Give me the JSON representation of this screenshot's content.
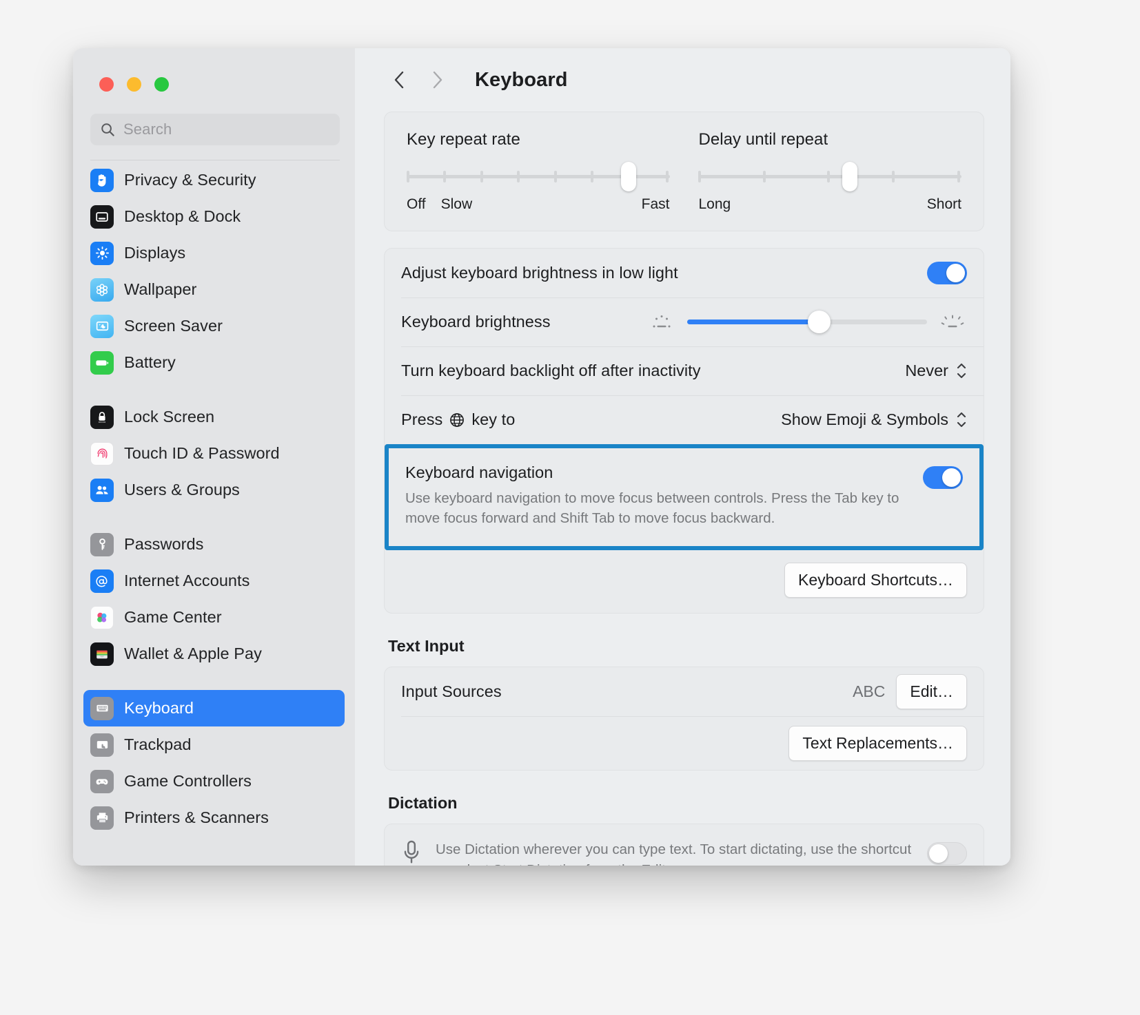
{
  "window": {
    "traffic_lights": [
      "close",
      "minimize",
      "zoom"
    ],
    "colors": {
      "accent": "#2f80f6",
      "highlight_border": "#1a84c7",
      "selected_row": "#2f80f6"
    }
  },
  "sidebar": {
    "search": {
      "placeholder": "Search",
      "value": "",
      "icon": "search-icon"
    },
    "groups": [
      {
        "items": [
          {
            "label": "Privacy & Security",
            "icon": "hand-raised-icon",
            "selected": false
          },
          {
            "label": "Desktop & Dock",
            "icon": "desktop-dock-icon",
            "selected": false
          },
          {
            "label": "Displays",
            "icon": "display-brightness-icon",
            "selected": false
          },
          {
            "label": "Wallpaper",
            "icon": "wallpaper-flower-icon",
            "selected": false
          },
          {
            "label": "Screen Saver",
            "icon": "screen-saver-icon",
            "selected": false
          },
          {
            "label": "Battery",
            "icon": "battery-icon",
            "selected": false
          }
        ]
      },
      {
        "items": [
          {
            "label": "Lock Screen",
            "icon": "lock-icon",
            "selected": false
          },
          {
            "label": "Touch ID & Password",
            "icon": "fingerprint-icon",
            "selected": false
          },
          {
            "label": "Users & Groups",
            "icon": "users-groups-icon",
            "selected": false
          }
        ]
      },
      {
        "items": [
          {
            "label": "Passwords",
            "icon": "key-icon",
            "selected": false
          },
          {
            "label": "Internet Accounts",
            "icon": "at-sign-icon",
            "selected": false
          },
          {
            "label": "Game Center",
            "icon": "game-center-icon",
            "selected": false
          },
          {
            "label": "Wallet & Apple Pay",
            "icon": "wallet-icon",
            "selected": false
          }
        ]
      },
      {
        "items": [
          {
            "label": "Keyboard",
            "icon": "keyboard-icon",
            "selected": true
          },
          {
            "label": "Trackpad",
            "icon": "trackpad-icon",
            "selected": false
          },
          {
            "label": "Game Controllers",
            "icon": "game-controller-icon",
            "selected": false
          },
          {
            "label": "Printers & Scanners",
            "icon": "printer-icon",
            "selected": false
          }
        ]
      }
    ]
  },
  "toolbar": {
    "back_icon": "chevron-left-icon",
    "forward_icon": "chevron-right-icon",
    "title": "Keyboard"
  },
  "repeat_card": {
    "key_repeat": {
      "title": "Key repeat rate",
      "ticks": 8,
      "value_index": 7,
      "labels": {
        "off": "Off",
        "min": "Slow",
        "max": "Fast"
      }
    },
    "delay_repeat": {
      "title": "Delay until repeat",
      "ticks": 5,
      "value_index": 4,
      "labels": {
        "min": "Long",
        "max": "Short"
      }
    }
  },
  "backlight_card": {
    "rows": [
      {
        "label": "Adjust keyboard brightness in low light",
        "control": "toggle",
        "value": "on"
      },
      {
        "label": "Keyboard brightness",
        "control": "slider",
        "percent": 55,
        "icon_low": "brightness-low-icon",
        "icon_high": "brightness-high-icon"
      },
      {
        "label": "Turn keyboard backlight off after inactivity",
        "control": "popup",
        "value": "Never"
      },
      {
        "label_prefix": "Press",
        "label_icon": "globe-icon",
        "label_suffix": "key to",
        "control": "popup",
        "value": "Show Emoji & Symbols"
      }
    ],
    "keyboard_navigation": {
      "title": "Keyboard navigation",
      "description": "Use keyboard navigation to move focus between controls. Press the Tab key to move focus forward and Shift Tab to move focus backward.",
      "toggle": "on",
      "highlighted": true
    },
    "shortcuts_button": "Keyboard Shortcuts…"
  },
  "text_input": {
    "section_title": "Text Input",
    "input_sources": {
      "label": "Input Sources",
      "value": "ABC",
      "button": "Edit…"
    },
    "text_replacements_button": "Text Replacements…"
  },
  "dictation": {
    "section_title": "Dictation",
    "icon": "microphone-icon",
    "description": "Use Dictation wherever you can type text. To start dictating, use the shortcut or select Start Dictation from the Edit menu.",
    "toggle": "off"
  }
}
